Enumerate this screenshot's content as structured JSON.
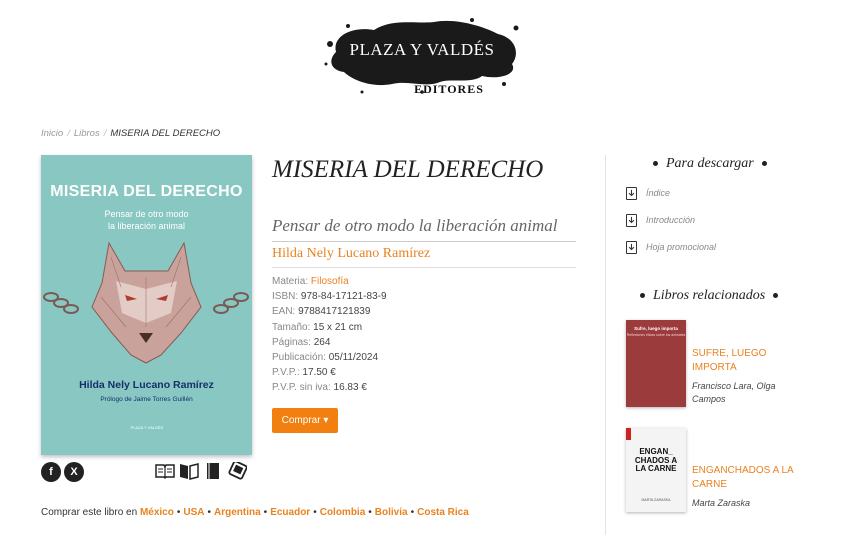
{
  "logo": {
    "title": "PLAZA Y VALDÉS",
    "subtitle": "EDITORES"
  },
  "breadcrumb": {
    "home": "Inicio",
    "books": "Libros",
    "current": "MISERIA DEL DERECHO",
    "sep": "/"
  },
  "cover": {
    "title": "MISERIA DEL DERECHO",
    "subtitle_line1": "Pensar de otro modo",
    "subtitle_line2": "la liberación animal",
    "author": "Hilda Nely Lucano Ramírez",
    "prologue": "Prólogo de Jaime Torres Guillén",
    "publisher": "PLAZA Y VALDÉS"
  },
  "book": {
    "title": "MISERIA DEL DERECHO",
    "subtitle": "Pensar de otro modo la liberación animal",
    "author": "Hilda Nely Lucano Ramírez",
    "details": {
      "materia_label": "Materia:",
      "materia": "Filosofía",
      "isbn_label": "ISBN:",
      "isbn": "978-84-17121-83-9",
      "ean_label": "EAN:",
      "ean": "9788417121839",
      "size_label": "Tamaño:",
      "size": "15 x 21 cm",
      "pages_label": "Páginas:",
      "pages": "264",
      "pub_label": "Publicación:",
      "pub": "05/11/2024",
      "pvp_label": "P.V.P.:",
      "pvp": "17.50 €",
      "pvp_noiva_label": "P.V.P. sin iva:",
      "pvp_noiva": "16.83 €"
    },
    "buy_label": "Comprar ▾"
  },
  "share": {
    "facebook": "f",
    "x": "X"
  },
  "formats": [
    "open-book-icon",
    "reading-book-icon",
    "closed-book-icon",
    "ebook-icon"
  ],
  "countries": {
    "prefix": "Comprar este libro en",
    "list": [
      "México",
      "USA",
      "Argentina",
      "Ecuador",
      "Colombia",
      "Bolivia",
      "Costa Rica"
    ],
    "sep": "•"
  },
  "sidebar": {
    "downloads_heading": "Para descargar",
    "downloads": [
      "Índice",
      "Introducción",
      "Hoja promocional"
    ],
    "related_heading": "Libros relacionados",
    "related": [
      {
        "title": "SUFRE, LUEGO IMPORTA",
        "author": "Francisco Lara, Olga Campos",
        "cover_title": "Sufre, luego importa",
        "cover_sub": "Reflexiones éticas sobre los animales"
      },
      {
        "title": "ENGANCHADOS A LA CARNE",
        "author": "Marta Zaraska",
        "cover_title": "ENGAN_ CHADOS A LA CARNE",
        "cover_sub": "MARTA ZARASKA"
      }
    ]
  },
  "colors": {
    "accent": "#e9821f",
    "button": "#f28010",
    "cover_bg": "#88c7c2",
    "cover_text": "#15306b"
  }
}
